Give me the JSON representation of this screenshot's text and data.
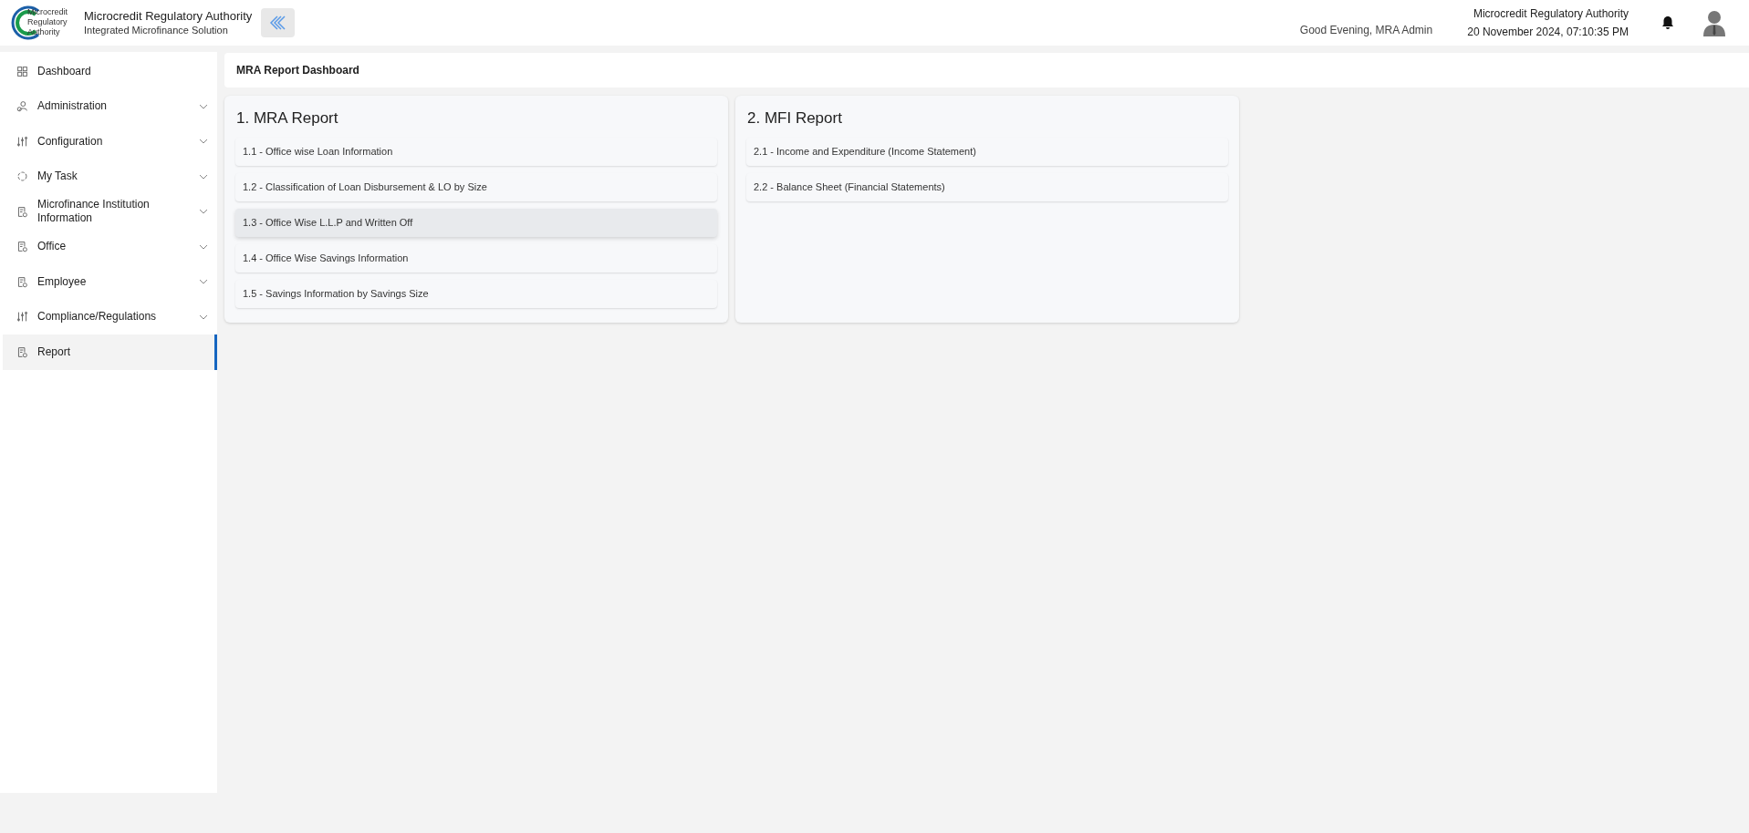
{
  "header": {
    "org_name": "Microcredit Regulatory Authority",
    "subtitle": "Integrated Microfinance Solution",
    "logo_text": [
      "Microcredit",
      "Regulatory",
      "Authority"
    ],
    "greeting": "Good Evening, MRA Admin",
    "right_org": "Microcredit Regulatory Authority",
    "datetime": "20 November 2024, 07:10:35 PM"
  },
  "sidebar": {
    "items": [
      {
        "label": "Dashboard",
        "expandable": false,
        "selected": false
      },
      {
        "label": "Administration",
        "expandable": true,
        "selected": false
      },
      {
        "label": "Configuration",
        "expandable": true,
        "selected": false
      },
      {
        "label": "My Task",
        "expandable": true,
        "selected": false
      },
      {
        "label": "Microfinance Institution Information",
        "expandable": true,
        "selected": false
      },
      {
        "label": "Office",
        "expandable": true,
        "selected": false
      },
      {
        "label": "Employee",
        "expandable": true,
        "selected": false
      },
      {
        "label": "Compliance/Regulations",
        "expandable": true,
        "selected": false
      },
      {
        "label": "Report",
        "expandable": false,
        "selected": true
      }
    ]
  },
  "page_title": "MRA Report Dashboard",
  "sections": [
    {
      "title": "1. MRA Report",
      "items": [
        {
          "label": "1.1 - Office wise Loan Information",
          "hovered": false
        },
        {
          "label": "1.2 - Classification of Loan Disbursement & LO by Size",
          "hovered": false
        },
        {
          "label": "1.3 - Office Wise L.L.P and Written Off",
          "hovered": true
        },
        {
          "label": "1.4 - Office Wise Savings Information",
          "hovered": false
        },
        {
          "label": "1.5 - Savings Information by Savings Size",
          "hovered": false
        }
      ]
    },
    {
      "title": "2. MFI Report",
      "items": [
        {
          "label": "2.1 - Income and Expenditure (Income Statement)",
          "hovered": false
        },
        {
          "label": "2.2 - Balance Sheet (Financial Statements)",
          "hovered": false
        }
      ]
    }
  ]
}
